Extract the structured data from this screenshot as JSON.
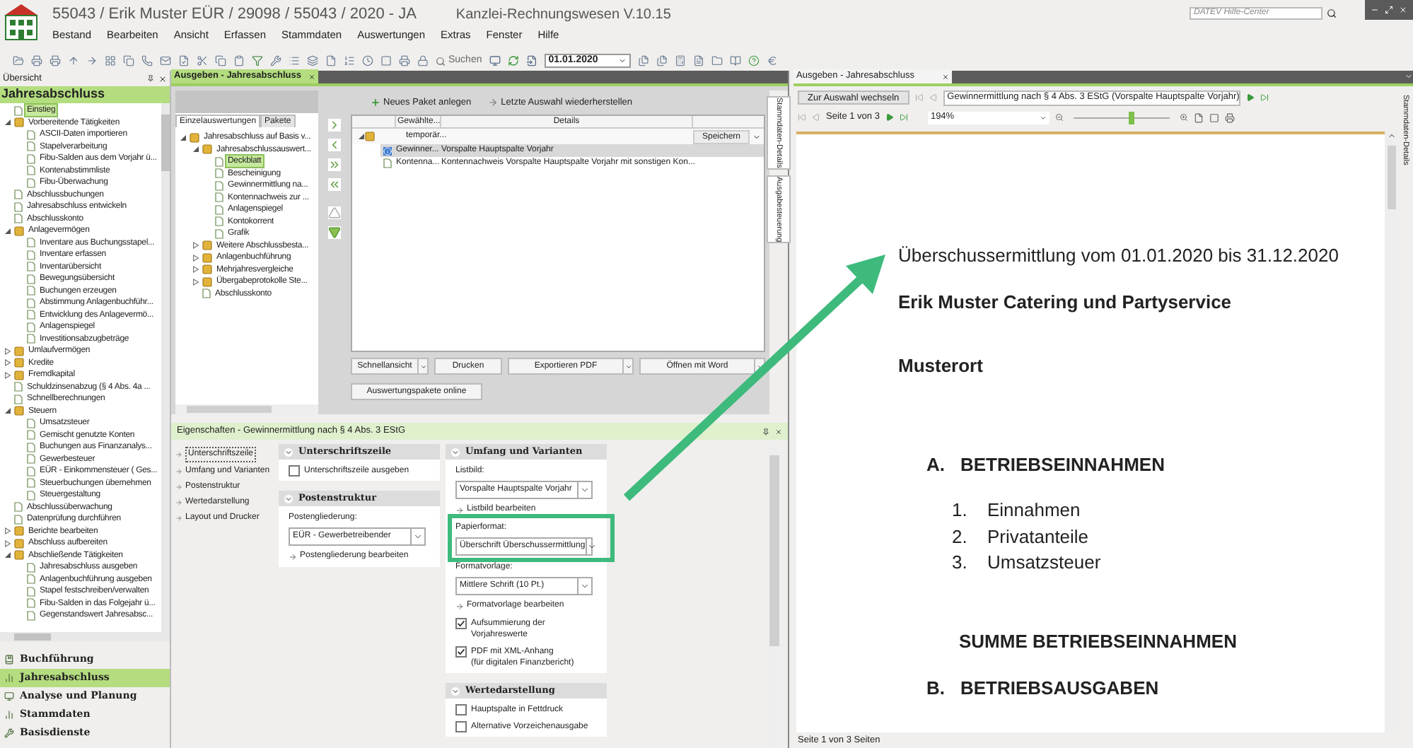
{
  "window": {
    "title": "55043 / Erik Muster EÜR / 29098 / 55043 / 2020 - JA",
    "app_name": "Kanzlei-Rechnungswesen V.10.15",
    "help_search": {
      "placeholder": "DATEV Hilfe-Center"
    }
  },
  "menu": [
    "Bestand",
    "Bearbeiten",
    "Ansicht",
    "Erfassen",
    "Stammdaten",
    "Auswertungen",
    "Extras",
    "Fenster",
    "Hilfe"
  ],
  "toolbar": {
    "search_label": "Suchen",
    "date": "01.01.2020"
  },
  "overview": {
    "tab": "Übersicht",
    "title": "Jahresabschluss",
    "tree": [
      {
        "label": "Einstieg",
        "kind": "page",
        "selected": true
      },
      {
        "label": "Vorbereitende Tätigkeiten",
        "kind": "folder",
        "expanded": true,
        "selected": false,
        "children": [
          {
            "label": "ASCII-Daten importieren",
            "kind": "page",
            "selected": false
          },
          {
            "label": "Stapelverarbeitung",
            "kind": "page",
            "selected": false
          },
          {
            "label": "Fibu-Salden aus dem Vorjahr ü...",
            "kind": "page",
            "selected": false
          },
          {
            "label": "Kontenabstimmliste",
            "kind": "page",
            "selected": false
          },
          {
            "label": "Fibu-Überwachung",
            "kind": "page",
            "selected": false
          }
        ]
      },
      {
        "label": "Abschlussbuchungen",
        "kind": "page",
        "selected": false
      },
      {
        "label": "Jahresabschluss entwickeln",
        "kind": "page",
        "selected": false
      },
      {
        "label": "Abschlusskonto",
        "kind": "page",
        "selected": false
      },
      {
        "label": "Anlagevermögen",
        "kind": "folder",
        "expanded": true,
        "selected": false,
        "children": [
          {
            "label": "Inventare aus Buchungsstapel...",
            "kind": "page",
            "selected": false
          },
          {
            "label": "Inventare erfassen",
            "kind": "page",
            "selected": false
          },
          {
            "label": "Inventarübersicht",
            "kind": "page",
            "selected": false
          },
          {
            "label": "Bewegungsübersicht",
            "kind": "page",
            "selected": false
          },
          {
            "label": "Buchungen erzeugen",
            "kind": "page",
            "selected": false
          },
          {
            "label": "Abstimmung Anlagenbuchführ...",
            "kind": "page",
            "selected": false
          },
          {
            "label": "Entwicklung des Anlagevermö...",
            "kind": "page",
            "selected": false
          },
          {
            "label": "Anlagenspiegel",
            "kind": "page",
            "selected": false
          },
          {
            "label": "Investitionsabzugbeträge",
            "kind": "page",
            "selected": false
          }
        ]
      },
      {
        "label": "Umlaufvermögen",
        "kind": "folder",
        "expanded": false,
        "selected": false
      },
      {
        "label": "Kredite",
        "kind": "folder",
        "expanded": false,
        "selected": false
      },
      {
        "label": "Fremdkapital",
        "kind": "folder",
        "expanded": false,
        "selected": false
      },
      {
        "label": "Schuldzinsenabzug (§ 4 Abs. 4a ...",
        "kind": "page",
        "selected": false
      },
      {
        "label": "Schnellberechnungen",
        "kind": "page",
        "selected": false
      },
      {
        "label": "Steuern",
        "kind": "folder",
        "expanded": true,
        "selected": false,
        "children": [
          {
            "label": "Umsatzsteuer",
            "kind": "page",
            "selected": false
          },
          {
            "label": "Gemischt genutzte Konten",
            "kind": "page",
            "selected": false
          },
          {
            "label": "Buchungen aus Finanzanalys...",
            "kind": "page",
            "selected": false
          },
          {
            "label": "Gewerbesteuer",
            "kind": "page",
            "selected": false
          },
          {
            "label": "EÜR - Einkommensteuer ( Ges...",
            "kind": "page",
            "selected": false
          },
          {
            "label": "Steuerbuchungen übernehmen",
            "kind": "page",
            "selected": false
          },
          {
            "label": "Steuergestaltung",
            "kind": "page",
            "selected": false
          }
        ]
      },
      {
        "label": "Abschlussüberwachung",
        "kind": "page",
        "selected": false
      },
      {
        "label": "Datenprüfung durchführen",
        "kind": "page",
        "selected": false
      },
      {
        "label": "Berichte bearbeiten",
        "kind": "folder",
        "expanded": false,
        "selected": false
      },
      {
        "label": "Abschluss aufbereiten",
        "kind": "folder",
        "expanded": false,
        "selected": false
      },
      {
        "label": "Abschließende Tätigkeiten",
        "kind": "folder",
        "expanded": true,
        "selected": false,
        "children": [
          {
            "label": "Jahresabschluss ausgeben",
            "kind": "page",
            "selected": false
          },
          {
            "label": "Anlagenbuchführung ausgeben",
            "kind": "page",
            "selected": false
          },
          {
            "label": "Stapel festschreiben/verwalten",
            "kind": "page",
            "selected": false
          },
          {
            "label": "Fibu-Salden in das Folgejahr ü...",
            "kind": "page",
            "selected": false
          },
          {
            "label": "Gegenstandswert Jahresabsc...",
            "kind": "page",
            "selected": false
          }
        ]
      }
    ],
    "nav": [
      {
        "label": "Buchführung",
        "selected": false
      },
      {
        "label": "Jahresabschluss",
        "selected": true
      },
      {
        "label": "Analyse und Planung",
        "selected": false
      },
      {
        "label": "Stammdaten",
        "selected": false
      },
      {
        "label": "Basisdienste",
        "selected": false
      }
    ]
  },
  "center": {
    "tab": "Ausgeben - Jahresabschluss",
    "subtabs": [
      {
        "label": "Einzelauswertungen",
        "selected": true
      },
      {
        "label": "Pakete",
        "selected": false
      }
    ],
    "tree": [
      {
        "label": "Jahresabschluss auf Basis v...",
        "kind": "folder",
        "expanded": true,
        "selected": false,
        "children": [
          {
            "label": "Jahresabschlussauswert...",
            "kind": "folder",
            "expanded": true,
            "selected": false,
            "children": [
              {
                "label": "Deckblatt",
                "kind": "page",
                "selected": true
              },
              {
                "label": "Bescheinigung",
                "kind": "page",
                "selected": false
              },
              {
                "label": "Gewinnermittlung na...",
                "kind": "page",
                "selected": false
              },
              {
                "label": "Kontennachweis zur ...",
                "kind": "page",
                "selected": false
              },
              {
                "label": "Anlagenspiegel",
                "kind": "page",
                "selected": false
              },
              {
                "label": "Kontokorrent",
                "kind": "page",
                "selected": false
              },
              {
                "label": "Grafik",
                "kind": "page",
                "selected": false
              }
            ]
          },
          {
            "label": "Weitere Abschlussbesta...",
            "kind": "folder",
            "expanded": false,
            "selected": false
          },
          {
            "label": "Anlagenbuchführung",
            "kind": "folder",
            "expanded": false,
            "selected": false
          },
          {
            "label": "Mehrjahresvergleiche",
            "kind": "folder",
            "expanded": false,
            "selected": false
          },
          {
            "label": "Übergabeprotokolle Ste...",
            "kind": "folder",
            "expanded": false,
            "selected": false
          },
          {
            "label": "Abschlusskonto",
            "kind": "page",
            "selected": false
          }
        ]
      }
    ],
    "actions": [
      "Neues Paket anlegen",
      "Letzte Auswahl wiederherstellen"
    ],
    "table": {
      "columns": [
        "Gewählte...",
        "Details"
      ],
      "group": {
        "label": "temporär...",
        "button": "Speichern",
        "rows": [
          {
            "name": "Gewinner...",
            "details": "Vorspalte Hauptspalte Vorjahr",
            "kind": "info",
            "selected": true
          },
          {
            "name": "Kontenna...",
            "details": "Kontennachweis Vorspalte Hauptspalte Vorjahr mit sonstigen Kon...",
            "kind": "page",
            "selected": false
          }
        ]
      }
    },
    "buttons": [
      {
        "label": "Schnellansicht",
        "dropdown": true
      },
      {
        "label": "Drucken",
        "dropdown": false
      },
      {
        "label": "Exportieren PDF",
        "dropdown": true
      },
      {
        "label": "Öffnen mit Word",
        "dropdown": true
      }
    ],
    "online_button": "Auswertungspakete online",
    "side_tabs": [
      "Stammdaten-Details",
      "Ausgabesteuerung"
    ]
  },
  "properties": {
    "title": "Eigenschaften - Gewinnermittlung nach § 4 Abs. 3 EStG",
    "nav": [
      {
        "label": "Unterschriftszeile",
        "selected": true
      },
      {
        "label": "Umfang und Varianten",
        "selected": false
      },
      {
        "label": "Postenstruktur",
        "selected": false
      },
      {
        "label": "Wertedarstellung",
        "selected": false
      },
      {
        "label": "Layout und Drucker",
        "selected": false
      }
    ],
    "columns": [
      [
        {
          "title": "Unterschriftszeile",
          "items": [
            {
              "kind": "checkbox",
              "label": "Unterschriftszeile ausgeben",
              "checked": false
            }
          ]
        },
        {
          "title": "Postenstruktur",
          "items": [
            {
              "kind": "select",
              "label": "Postengliederung:",
              "value": "EÜR - Gewerbetreibender"
            },
            {
              "kind": "link",
              "label": "Postengliederung bearbeiten"
            }
          ]
        }
      ],
      [
        {
          "title": "Umfang und Varianten",
          "items": [
            {
              "kind": "select",
              "label": "Listbild:",
              "value": "Vorspalte Hauptspalte Vorjahr"
            },
            {
              "kind": "link",
              "label": "Listbild bearbeiten"
            },
            {
              "kind": "select",
              "label": "Papierformat:",
              "value": "Überschrift Überschussermittlung"
            },
            {
              "kind": "select",
              "label": "Formatvorlage:",
              "value": "Mittlere Schrift (10 Pt.)"
            },
            {
              "kind": "link",
              "label": "Formatvorlage bearbeiten"
            },
            {
              "kind": "checkbox",
              "label": "Aufsummierung der Vorjahreswerte",
              "checked": true
            },
            {
              "kind": "checkbox",
              "label": "PDF mit XML-Anhang",
              "note": "(für digitalen Finanzbericht)",
              "checked": true
            }
          ]
        },
        {
          "title": "Wertedarstellung",
          "items": [
            {
              "kind": "checkbox",
              "label": "Hauptspalte in Fettdruck",
              "checked": false
            },
            {
              "kind": "checkbox",
              "label": "Alternative Vorzeichenausgabe",
              "checked": false
            }
          ]
        }
      ]
    ]
  },
  "preview": {
    "tab": "Ausgeben - Jahresabschluss",
    "switch_button": "Zur Auswahl wechseln",
    "report_select": "Gewinnermittlung nach § 4 Abs. 3 EStG (Vorspalte Hauptspalte Vorjahr)",
    "page_label": "Seite 1 von 3",
    "zoom": "194%",
    "zoom_slider": {
      "level": 0.6
    },
    "side_tab": "Stammdaten-Details",
    "document": {
      "heading": "Überschussermittlung vom 01.01.2020 bis 31.12.2020",
      "company": "Erik Muster Catering und Partyservice",
      "place": "Musterort",
      "sections": [
        {
          "letter": "A.",
          "title": "BETRIEBSEINNAHMEN",
          "items": [
            {
              "number": "1.",
              "label": "Einnahmen"
            },
            {
              "number": "2.",
              "label": "Privatanteile"
            },
            {
              "number": "3.",
              "label": "Umsatzsteuer"
            }
          ],
          "sum": "SUMME BETRIEBSEINNAHMEN"
        },
        {
          "letter": "B.",
          "title": "BETRIEBSAUSGABEN"
        }
      ]
    },
    "status": "Seite 1 von 3 Seiten"
  }
}
